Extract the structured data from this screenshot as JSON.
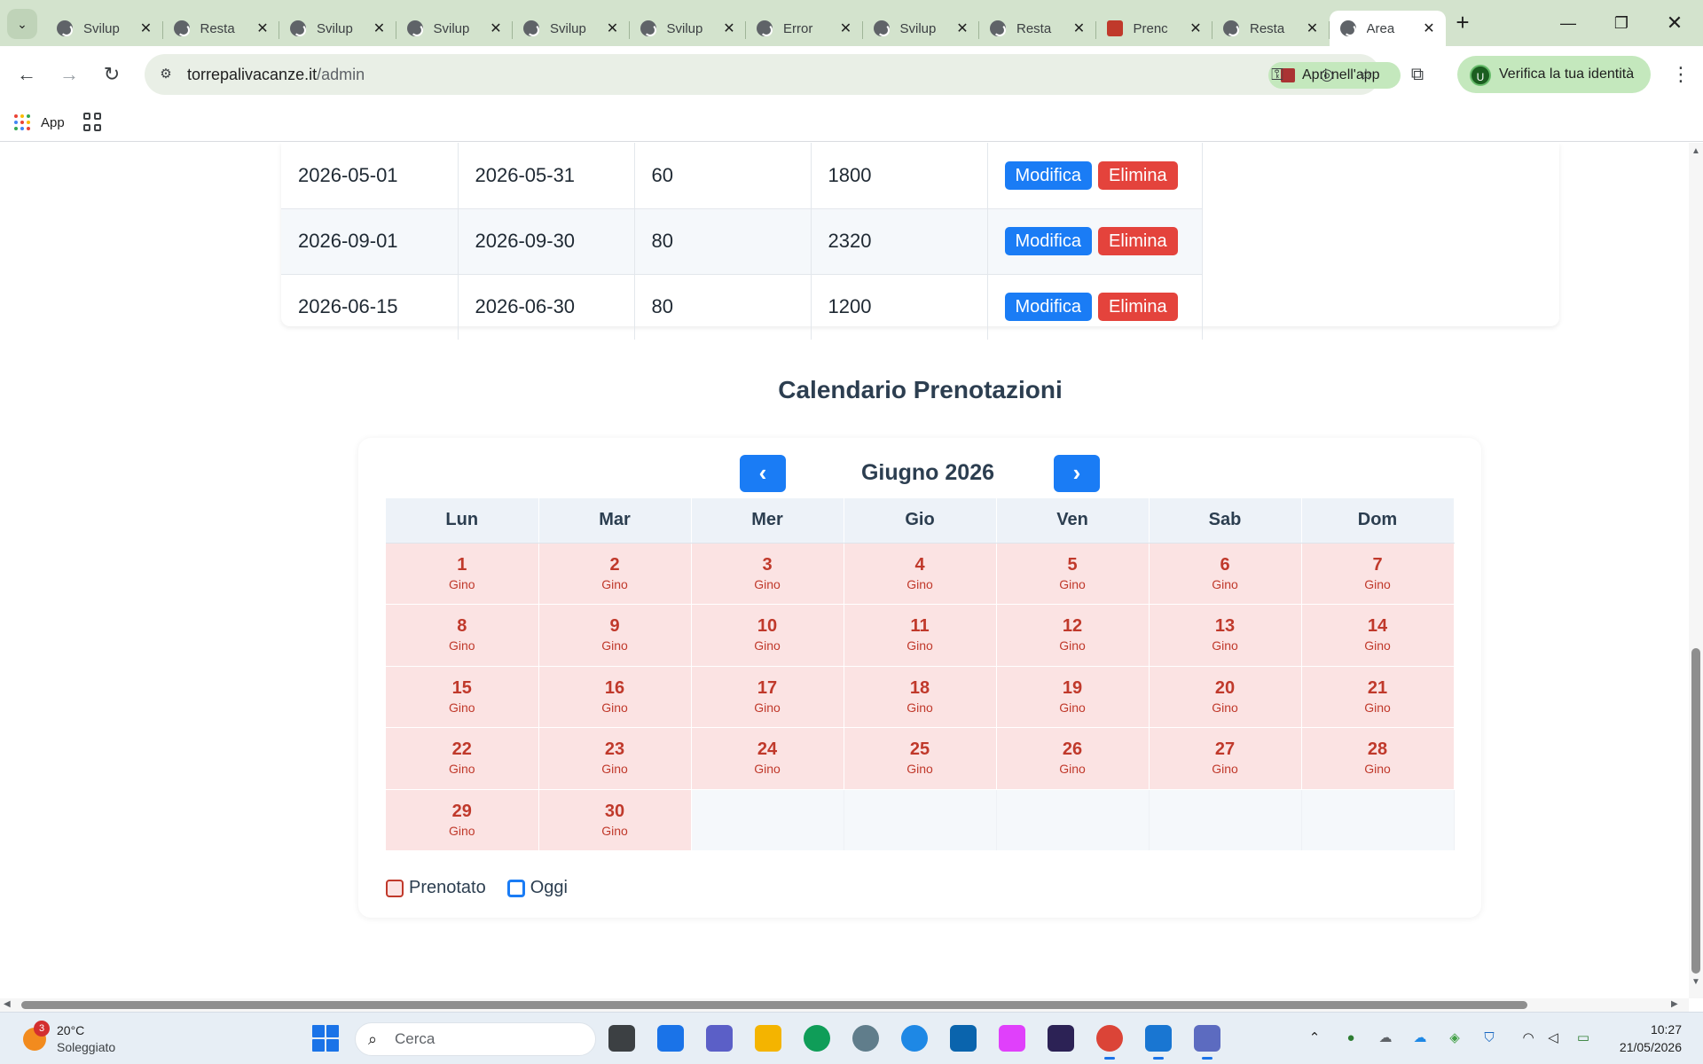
{
  "browser": {
    "tabs": [
      {
        "title": "Svilup",
        "favicon": "globe-icon",
        "active": false
      },
      {
        "title": "Resta",
        "favicon": "globe-icon",
        "active": false
      },
      {
        "title": "Svilup",
        "favicon": "globe-icon",
        "active": false
      },
      {
        "title": "Svilup",
        "favicon": "globe-icon",
        "active": false
      },
      {
        "title": "Svilup",
        "favicon": "globe-icon",
        "active": false
      },
      {
        "title": "Svilup",
        "favicon": "globe-icon",
        "active": false
      },
      {
        "title": "Error",
        "favicon": "globe-icon",
        "active": false
      },
      {
        "title": "Svilup",
        "favicon": "globe-icon",
        "active": false
      },
      {
        "title": "Resta",
        "favicon": "globe-icon",
        "active": false
      },
      {
        "title": "Prenc",
        "favicon": "tower-icon",
        "active": false
      },
      {
        "title": "Resta",
        "favicon": "globe-icon",
        "active": false
      },
      {
        "title": "Area",
        "favicon": "globe-icon",
        "active": true
      }
    ],
    "url_host": "torrepalivacanze.it",
    "url_path": "/admin",
    "open_in_app_label": "Apri nell'app",
    "verify_identity_label": "Verifica la tua identità",
    "profile_initial": "U",
    "bookmarks": {
      "apps_label": "App"
    },
    "theme_color": "#d3e3cd"
  },
  "rates_table": {
    "rows": [
      {
        "start": "2026-05-01",
        "end": "2026-05-31",
        "price": "60",
        "total": "1800"
      },
      {
        "start": "2026-09-01",
        "end": "2026-09-30",
        "price": "80",
        "total": "2320"
      },
      {
        "start": "2026-06-15",
        "end": "2026-06-30",
        "price": "80",
        "total": "1200"
      }
    ],
    "edit_label": "Modifica",
    "delete_label": "Elimina",
    "edit_color": "#1a7cf5",
    "delete_color": "#e4433c"
  },
  "calendar": {
    "title": "Calendario Prenotazioni",
    "month_label": "Giugno 2026",
    "prev_label": "‹",
    "next_label": "›",
    "weekdays": [
      "Lun",
      "Mar",
      "Mer",
      "Gio",
      "Ven",
      "Sab",
      "Dom"
    ],
    "weeks": [
      [
        {
          "day": "1",
          "guest": "Gino"
        },
        {
          "day": "2",
          "guest": "Gino"
        },
        {
          "day": "3",
          "guest": "Gino"
        },
        {
          "day": "4",
          "guest": "Gino"
        },
        {
          "day": "5",
          "guest": "Gino"
        },
        {
          "day": "6",
          "guest": "Gino"
        },
        {
          "day": "7",
          "guest": "Gino"
        }
      ],
      [
        {
          "day": "8",
          "guest": "Gino"
        },
        {
          "day": "9",
          "guest": "Gino"
        },
        {
          "day": "10",
          "guest": "Gino"
        },
        {
          "day": "11",
          "guest": "Gino"
        },
        {
          "day": "12",
          "guest": "Gino"
        },
        {
          "day": "13",
          "guest": "Gino"
        },
        {
          "day": "14",
          "guest": "Gino"
        }
      ],
      [
        {
          "day": "15",
          "guest": "Gino"
        },
        {
          "day": "16",
          "guest": "Gino"
        },
        {
          "day": "17",
          "guest": "Gino"
        },
        {
          "day": "18",
          "guest": "Gino"
        },
        {
          "day": "19",
          "guest": "Gino"
        },
        {
          "day": "20",
          "guest": "Gino"
        },
        {
          "day": "21",
          "guest": "Gino"
        }
      ],
      [
        {
          "day": "22",
          "guest": "Gino"
        },
        {
          "day": "23",
          "guest": "Gino"
        },
        {
          "day": "24",
          "guest": "Gino"
        },
        {
          "day": "25",
          "guest": "Gino"
        },
        {
          "day": "26",
          "guest": "Gino"
        },
        {
          "day": "27",
          "guest": "Gino"
        },
        {
          "day": "28",
          "guest": "Gino"
        }
      ],
      [
        {
          "day": "29",
          "guest": "Gino"
        },
        {
          "day": "30",
          "guest": "Gino"
        },
        null,
        null,
        null,
        null,
        null
      ]
    ],
    "legend": {
      "booked": "Prenotato",
      "today": "Oggi"
    },
    "booked_color": "#c0392b",
    "booked_bg": "#fbe3e3",
    "today_color": "#1a7cf5"
  },
  "taskbar": {
    "weather_temp": "20°C",
    "weather_desc": "Soleggiato",
    "weather_badge": "3",
    "search_placeholder": "Cerca",
    "apps": [
      "task-view-icon",
      "store-icon",
      "teams-icon",
      "file-explorer-icon",
      "edge-icon",
      "vpn-icon",
      "edge-dev-icon",
      "outlook-icon",
      "copilot-icon",
      "eclipse-icon",
      "chrome-icon",
      "vscode-icon",
      "snipping-tool-icon"
    ],
    "time": "10:27",
    "date": "21/05/2026"
  }
}
